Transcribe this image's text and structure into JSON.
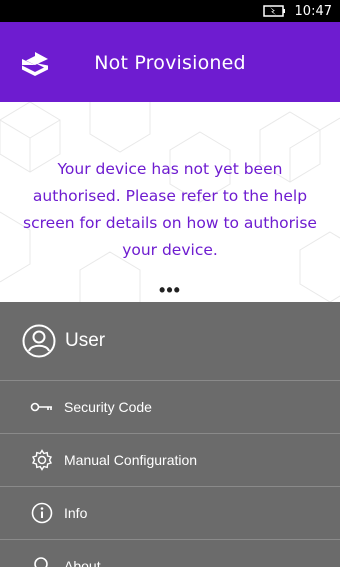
{
  "status_bar": {
    "time": "10:47"
  },
  "header": {
    "title": "Not Provisioned",
    "accent_color": "#6e1cd0"
  },
  "main": {
    "message": "Your device has not yet been authorised. Please refer to the help screen for details on how to authorise your device.",
    "more_glyph": "•••"
  },
  "menu": {
    "user_label": "User",
    "items": [
      {
        "label": "Security Code",
        "icon": "key-icon"
      },
      {
        "label": "Manual Configuration",
        "icon": "gear-icon"
      },
      {
        "label": "Info",
        "icon": "info-icon"
      },
      {
        "label": "About",
        "icon": "search-icon"
      }
    ]
  }
}
